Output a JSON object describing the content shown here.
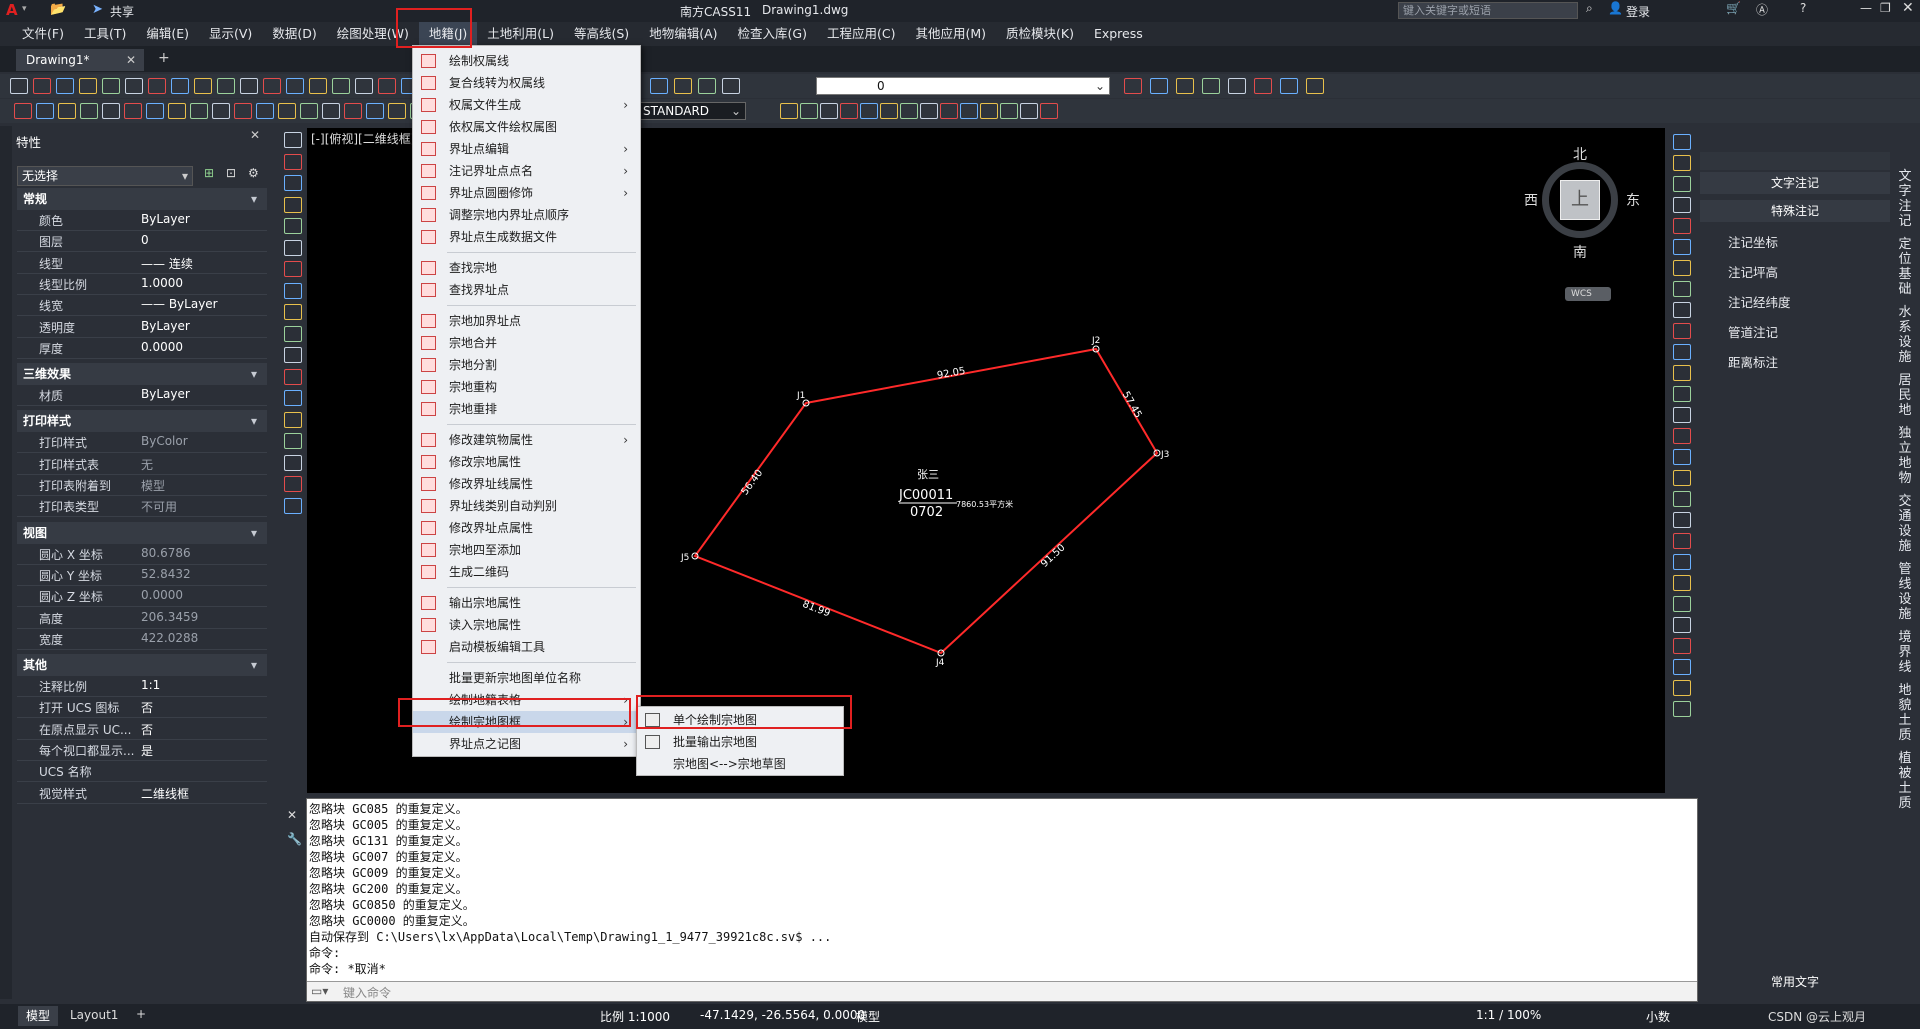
{
  "window": {
    "app_title": "南方CASS11",
    "doc_title": "Drawing1.dwg",
    "share_label": "共享",
    "search_placeholder": "键入关键字或短语",
    "login_label": "登录"
  },
  "menubar": [
    "文件(F)",
    "工具(T)",
    "编辑(E)",
    "显示(V)",
    "数据(D)",
    "绘图处理(W)",
    "地籍(J)",
    "土地利用(L)",
    "等高线(S)",
    "地物编辑(A)",
    "检查入库(G)",
    "工程应用(C)",
    "其他应用(M)",
    "质检模块(K)",
    "Express"
  ],
  "doc_tabs": {
    "active": "Drawing1*",
    "close": "✕",
    "add": "+"
  },
  "toolbar": {
    "layer_value": "0",
    "style_value": "STANDARD"
  },
  "properties": {
    "title": "特性",
    "selection": "无选择",
    "sections": [
      {
        "name": "常规",
        "rows": [
          [
            "颜色",
            "ByLayer"
          ],
          [
            "图层",
            "0"
          ],
          [
            "线型",
            "—— 连续"
          ],
          [
            "线型比例",
            "1.0000"
          ],
          [
            "线宽",
            "—— ByLayer"
          ],
          [
            "透明度",
            "ByLayer"
          ],
          [
            "厚度",
            "0.0000"
          ]
        ]
      },
      {
        "name": "三维效果",
        "rows": [
          [
            "材质",
            "ByLayer"
          ]
        ]
      },
      {
        "name": "打印样式",
        "rows": [
          [
            "打印样式",
            "ByColor"
          ],
          [
            "打印样式表",
            "无"
          ],
          [
            "打印表附着到",
            "模型"
          ],
          [
            "打印表类型",
            "不可用"
          ]
        ]
      },
      {
        "name": "视图",
        "rows": [
          [
            "圆心 X 坐标",
            "80.6786"
          ],
          [
            "圆心 Y 坐标",
            "52.8432"
          ],
          [
            "圆心 Z 坐标",
            "0.0000"
          ],
          [
            "高度",
            "206.3459"
          ],
          [
            "宽度",
            "422.0288"
          ]
        ]
      },
      {
        "name": "其他",
        "rows": [
          [
            "注释比例",
            "1:1"
          ],
          [
            "打开 UCS 图标",
            "否"
          ],
          [
            "在原点显示 UC...",
            "否"
          ],
          [
            "每个视口都显示...",
            "是"
          ],
          [
            "UCS 名称",
            ""
          ],
          [
            "视觉样式",
            "二维线框"
          ]
        ]
      }
    ]
  },
  "viewport_label": "[-][俯视][二维线框]",
  "compass": {
    "n": "北",
    "s": "南",
    "e": "东",
    "w": "西",
    "center": "上",
    "wcs": "WCS"
  },
  "drawing": {
    "points": [
      "J1",
      "J2",
      "J3",
      "J4",
      "J5"
    ],
    "edges": [
      "92.05",
      "57.45",
      "91.50",
      "81.99",
      "56.40"
    ],
    "owner": "张三",
    "parcel_no": "JC00011",
    "sub_no": "0702",
    "area": "7860.53平方米"
  },
  "menu_dijia": {
    "items": [
      {
        "label": "绘制权属线",
        "arrow": false
      },
      {
        "label": "复合线转为权属线",
        "arrow": false
      },
      {
        "label": "权属文件生成",
        "arrow": true
      },
      {
        "label": "依权属文件绘权属图",
        "arrow": false
      },
      {
        "label": "界址点编辑",
        "arrow": true
      },
      {
        "label": "注记界址点点名",
        "arrow": true
      },
      {
        "label": "界址点圆圈修饰",
        "arrow": true
      },
      {
        "label": "调整宗地内界址点顺序",
        "arrow": false
      },
      {
        "label": "界址点生成数据文件",
        "arrow": false
      },
      {
        "label": "查找宗地",
        "arrow": false
      },
      {
        "label": "查找界址点",
        "arrow": false
      },
      {
        "label": "宗地加界址点",
        "arrow": false
      },
      {
        "label": "宗地合并",
        "arrow": false
      },
      {
        "label": "宗地分割",
        "arrow": false
      },
      {
        "label": "宗地重构",
        "arrow": false
      },
      {
        "label": "宗地重排",
        "arrow": false
      },
      {
        "label": "修改建筑物属性",
        "arrow": true
      },
      {
        "label": "修改宗地属性",
        "arrow": false
      },
      {
        "label": "修改界址线属性",
        "arrow": false
      },
      {
        "label": "界址线类别自动判别",
        "arrow": false
      },
      {
        "label": "修改界址点属性",
        "arrow": false
      },
      {
        "label": "宗地四至添加",
        "arrow": false
      },
      {
        "label": "生成二维码",
        "arrow": false
      },
      {
        "label": "输出宗地属性",
        "arrow": false
      },
      {
        "label": "读入宗地属性",
        "arrow": false
      },
      {
        "label": "启动模板编辑工具",
        "arrow": false
      },
      {
        "label": "批量更新宗地图单位名称",
        "arrow": false
      },
      {
        "label": "绘制地籍表格",
        "arrow": true
      },
      {
        "label": "绘制宗地图框",
        "arrow": true
      },
      {
        "label": "界址点之记图",
        "arrow": true
      }
    ]
  },
  "submenu": [
    "单个绘制宗地图",
    "批量输出宗地图",
    "宗地图<-->宗地草图"
  ],
  "right_panel": {
    "tab1": "文字注记",
    "tab2": "特殊注记",
    "items": [
      "注记坐标",
      "注记坪高",
      "注记经纬度",
      "管道注记",
      "距离标注"
    ],
    "footer": "常用文字"
  },
  "right_vtabs": [
    "文字注记",
    "定位基础",
    "水系设施",
    "居民地",
    "独立地物",
    "交通设施",
    "管线设施",
    "境界线",
    "地貌土质",
    "植被土质"
  ],
  "command": {
    "lines": [
      "忽略块 GC085 的重复定义。",
      "忽略块 GC005 的重复定义。",
      "忽略块 GC131 的重复定义。",
      "忽略块 GC007 的重复定义。",
      "忽略块 GC009 的重复定义。",
      "忽略块 GC200 的重复定义。",
      "忽略块 GC0850 的重复定义。",
      "忽略块 GC0000 的重复定义。",
      "自动保存到 C:\\Users\\lx\\AppData\\Local\\Temp\\Drawing1_1_9477_39921c8c.sv$ ...",
      "命令:",
      "命令: *取消*"
    ],
    "placeholder": "键入命令"
  },
  "status": {
    "model_tab": "模型",
    "layout_tab": "Layout1",
    "add": "+",
    "scale": "比例 1:1000",
    "coords": "-47.1429, -26.5564, 0.0000",
    "mode": "模型",
    "zoom": "1:1 / 100%",
    "units": "小数",
    "watermark": "CSDN @云上观月"
  }
}
